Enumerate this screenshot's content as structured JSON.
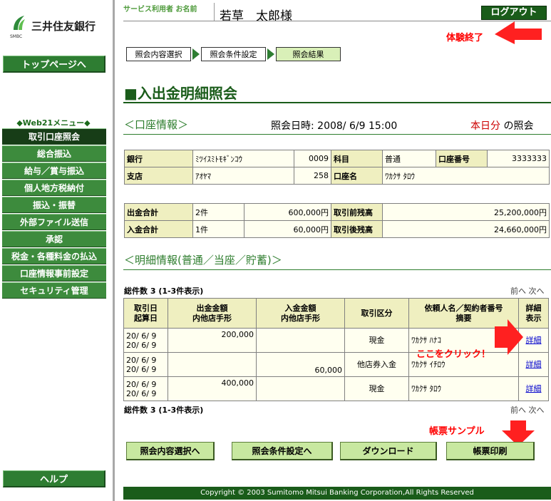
{
  "sidebar": {
    "bank_name": "三井住友銀行",
    "bank_sub": "SMBC",
    "top_page": "トップページへ",
    "menu_title": "◆Web21メニュー◆",
    "menu": [
      "取引口座照会",
      "総合振込",
      "給与／賞与振込",
      "個人地方税納付",
      "振込・振替",
      "外部ファイル送信",
      "承認",
      "税金・各種料金の払込",
      "口座情報事前設定",
      "セキュリティ管理"
    ],
    "help": "ヘルプ"
  },
  "header": {
    "name_label": "サービス利用者 お名前",
    "name_value": "若草　太郎様",
    "logout": "ログアウト",
    "logout_note": "体験終了"
  },
  "steps": [
    "照会内容選択",
    "照会条件設定",
    "照会結果"
  ],
  "page_title": "■入出金明細照会",
  "account_section": "＜口座情報＞",
  "inquiry_date": "照会日時:  2008/ 6/9 15:00",
  "inquiry_today_red": "本日分",
  "inquiry_today_rest": " の照会",
  "account": {
    "bank_label": "銀行",
    "bank_value": "ﾐﾂｲｽﾐﾄﾓｷﾞﾝｺｳ",
    "bank_code": "0009",
    "subject_label": "科目",
    "subject_value": "普通",
    "acct_no_label": "口座番号",
    "acct_no_value": "3333333",
    "branch_label": "支店",
    "branch_value": "ｱｵﾔﾏ",
    "branch_code": "258",
    "acct_name_label": "口座名",
    "acct_name_value": "ﾜｶｸｻ ﾀﾛｳ"
  },
  "totals": {
    "out_label": "出金合計",
    "out_count": "2件",
    "out_amount": "600,000円",
    "before_label": "取引前残高",
    "before_value": "25,200,000円",
    "in_label": "入金合計",
    "in_count": "1件",
    "in_amount": "60,000円",
    "after_label": "取引後残高",
    "after_value": "24,660,000円"
  },
  "detail_section": "＜明細情報(普通／当座／貯蓄)＞",
  "total_count": "総件数 3 (1-3件表示)",
  "pager": "前へ 次へ",
  "detail_headers": {
    "date": "取引日\n起算日",
    "out": "出金金額\n内他店手形",
    "in": "入金金額\n内他店手形",
    "kind": "取引区分",
    "payer": "依頼人名／契約者番号\n摘要",
    "detail": "詳細\n表示"
  },
  "rows": [
    {
      "date1": "20/ 6/ 9",
      "date2": "20/ 6/ 9",
      "out": "200,000",
      "out2": "",
      "in": "",
      "in2": "",
      "kind": "現金",
      "payer": "ﾜｶｸｻ ﾊﾅｺ",
      "link": "詳細"
    },
    {
      "date1": "20/ 6/ 9",
      "date2": "20/ 6/ 9",
      "out": "",
      "out2": "",
      "in": "",
      "in2": "60,000",
      "kind": "他店券入金",
      "payer": "ﾜｶｸｻ ｲﾁﾛｳ",
      "link": "詳細"
    },
    {
      "date1": "20/ 6/ 9",
      "date2": "20/ 6/ 9",
      "out": "400,000",
      "out2": "",
      "in": "",
      "in2": "",
      "kind": "現金",
      "payer": "ﾜｶｸｻ ﾀﾛｳ",
      "link": "詳細"
    }
  ],
  "click_note": "ここをクリック！",
  "sample_note": "帳票サンプル",
  "buttons": [
    "照会内容選択へ",
    "照会条件設定へ",
    "ダウンロード",
    "帳票印刷"
  ],
  "footer": "Copyright © 2003 Sumitomo Mitsui Banking Corporation,All Rights Reserved",
  "colors": {
    "brand_green": "#1a5c1a",
    "menu_green": "#3d8b3d",
    "accent_red": "#ff0000"
  }
}
